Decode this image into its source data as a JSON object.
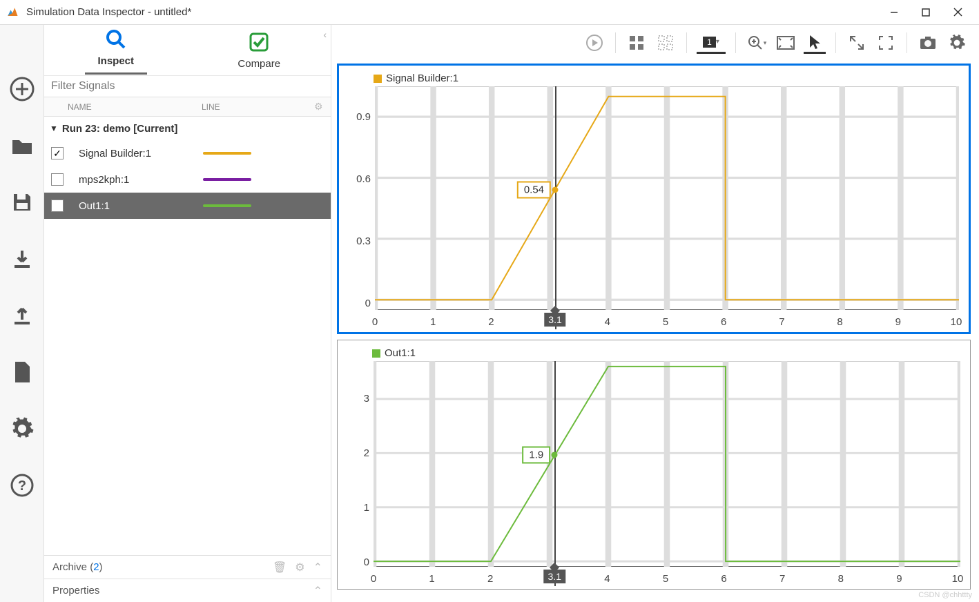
{
  "window": {
    "title": "Simulation Data Inspector - untitled*"
  },
  "tabs": {
    "inspect": "Inspect",
    "compare": "Compare"
  },
  "filter": {
    "placeholder": "Filter Signals"
  },
  "columns": {
    "name": "NAME",
    "line": "LINE"
  },
  "run": {
    "label": "Run 23: demo [Current]"
  },
  "signals": [
    {
      "name": "Signal Builder:1",
      "checked": true,
      "color": "#e6a817",
      "selected": false
    },
    {
      "name": "mps2kph:1",
      "checked": false,
      "color": "#7a1fa2",
      "selected": false
    },
    {
      "name": "Out1:1",
      "checked": false,
      "color": "#6cbb3c",
      "selected": true
    }
  ],
  "archive": {
    "label": "Archive",
    "count": "2"
  },
  "properties": {
    "label": "Properties"
  },
  "cursor": {
    "x": 3.1,
    "label": "3.1"
  },
  "chart_data": [
    {
      "type": "line",
      "title": "Signal Builder:1",
      "color": "#e6a817",
      "xlim": [
        0,
        10
      ],
      "ylim": [
        -0.05,
        1.05
      ],
      "xticks": [
        0,
        1,
        2,
        3,
        4,
        5,
        6,
        7,
        8,
        9,
        10
      ],
      "yticks": [
        0,
        0.3,
        0.6,
        0.9
      ],
      "x": [
        0,
        2,
        4,
        6,
        6.001,
        10
      ],
      "y": [
        0,
        0,
        1,
        1,
        0,
        0
      ],
      "cursor_value": "0.54"
    },
    {
      "type": "line",
      "title": "Out1:1",
      "color": "#6cbb3c",
      "xlim": [
        0,
        10
      ],
      "ylim": [
        -0.1,
        3.7
      ],
      "xticks": [
        0,
        1,
        2,
        3,
        4,
        5,
        6,
        7,
        8,
        9,
        10
      ],
      "yticks": [
        0,
        1,
        2,
        3
      ],
      "x": [
        0,
        2,
        4,
        6,
        6.001,
        10
      ],
      "y": [
        0,
        0,
        3.6,
        3.6,
        0,
        0
      ],
      "cursor_value": "1.9"
    }
  ],
  "toolbar": {
    "layout_badge": "1"
  },
  "watermark": "CSDN @chhttty"
}
